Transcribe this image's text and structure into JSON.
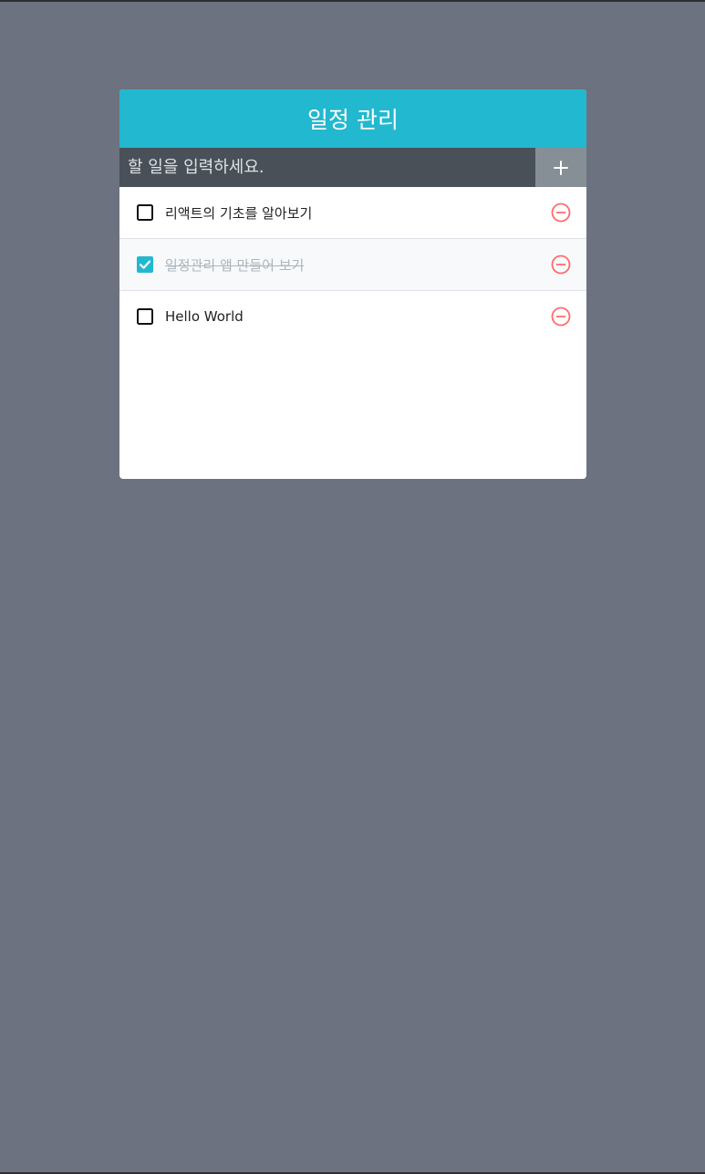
{
  "app": {
    "title": "일정 관리"
  },
  "insert": {
    "placeholder": "할 일을 입력하세요.",
    "value": "",
    "add_icon": "plus-icon"
  },
  "todos": [
    {
      "text": "리액트의 기초를 알아보기",
      "checked": false
    },
    {
      "text": "일정관리 앱 만들어 보기",
      "checked": true
    },
    {
      "text": "Hello World",
      "checked": false
    }
  ],
  "icons": {
    "checkbox_unchecked": "square-outline-icon",
    "checkbox_checked": "checked-square-icon",
    "remove": "minus-circle-icon"
  },
  "colors": {
    "page_background": "#6c727f",
    "header_background": "#22b8cf",
    "input_bar_background": "#495057",
    "add_button_background": "#868e96",
    "checked_color": "#22b8cf",
    "remove_color": "#ff6b6b",
    "done_text_color": "#adb5bd"
  }
}
